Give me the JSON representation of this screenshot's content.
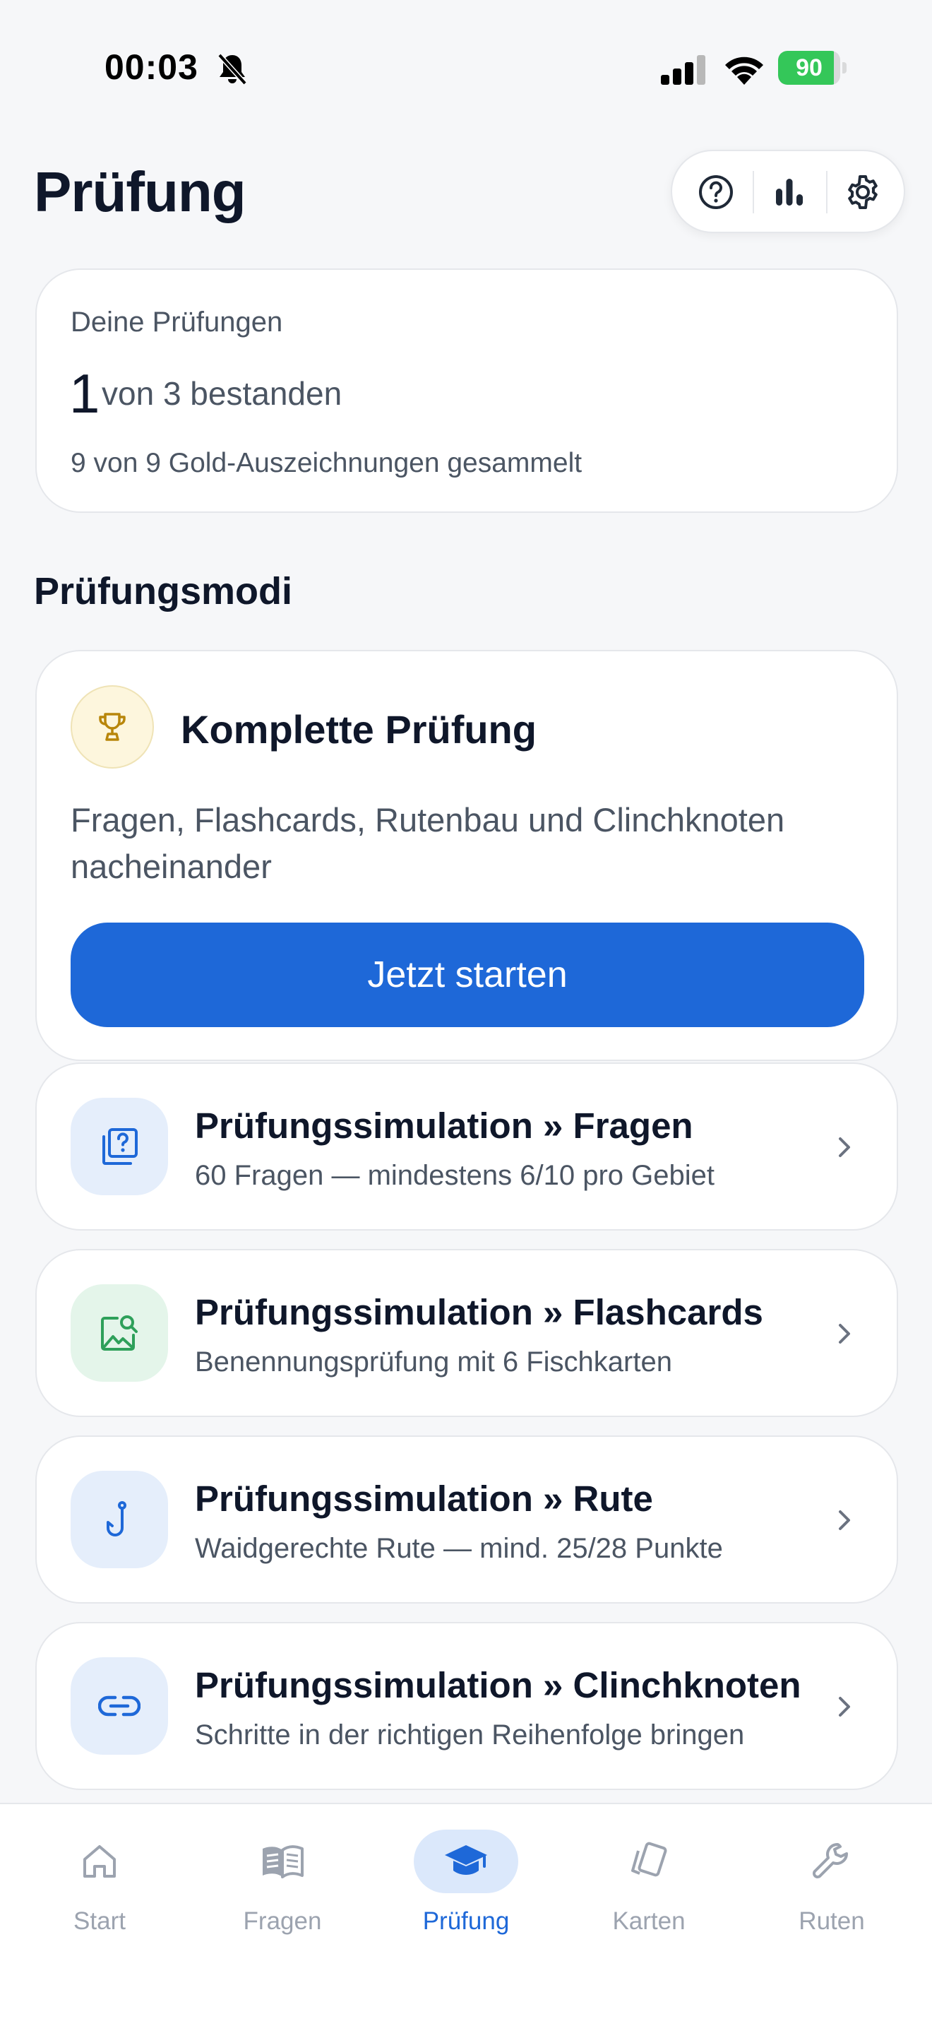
{
  "status_bar": {
    "time": "00:03",
    "battery_percent": "90",
    "battery_level": 0.9
  },
  "header": {
    "title": "Prüfung",
    "toolbar_icons": [
      "help-icon",
      "stats-icon",
      "settings-icon"
    ]
  },
  "summary": {
    "heading": "Deine Prüfungen",
    "passed_count": "1",
    "passed_label": "von 3 bestanden",
    "gold_text": "9 von 9 Gold-Auszeichnungen gesammelt"
  },
  "section": {
    "title": "Prüfungsmodi"
  },
  "hero": {
    "icon": "trophy-icon",
    "title": "Komplette Prüfung",
    "description": "Fragen, Flashcards, Rutenbau und Clinchknoten nacheinander",
    "button_label": "Jetzt starten"
  },
  "modes": [
    {
      "icon": "question-cards-icon",
      "title": "Prüfungssimulation » Fragen",
      "subtitle": "60 Fragen — mindestens 6/10 pro Gebiet",
      "icon_bg": "#e5eefb",
      "icon_color": "#1e68d8"
    },
    {
      "icon": "image-search-icon",
      "title": "Prüfungssimulation » Flashcards",
      "subtitle": "Benennungsprüfung mit 6 Fischkarten",
      "icon_bg": "#e4f5ea",
      "icon_color": "#2ea05a"
    },
    {
      "icon": "fishhook-icon",
      "title": "Prüfungssimulation » Rute",
      "subtitle": "Waidgerechte Rute — mind. 25/28 Punkte",
      "icon_bg": "#e5eefb",
      "icon_color": "#1e68d8"
    },
    {
      "icon": "link-icon",
      "title": "Prüfungssimulation » Clinchknoten",
      "subtitle": "Schritte in der richtigen Reihenfolge bringen",
      "icon_bg": "#e5eefb",
      "icon_color": "#1e68d8"
    }
  ],
  "tab_bar": {
    "tabs": [
      {
        "label": "Start",
        "icon": "home-icon",
        "active": false
      },
      {
        "label": "Fragen",
        "icon": "book-icon",
        "active": false
      },
      {
        "label": "Prüfung",
        "icon": "graduation-cap-icon",
        "active": true
      },
      {
        "label": "Karten",
        "icon": "cards-icon",
        "active": false
      },
      {
        "label": "Ruten",
        "icon": "wrench-icon",
        "active": false
      }
    ]
  },
  "colors": {
    "accent": "#1e68d8",
    "background": "#f6f7f9",
    "trophy": "#b8860b",
    "battery_green": "#34c759"
  }
}
